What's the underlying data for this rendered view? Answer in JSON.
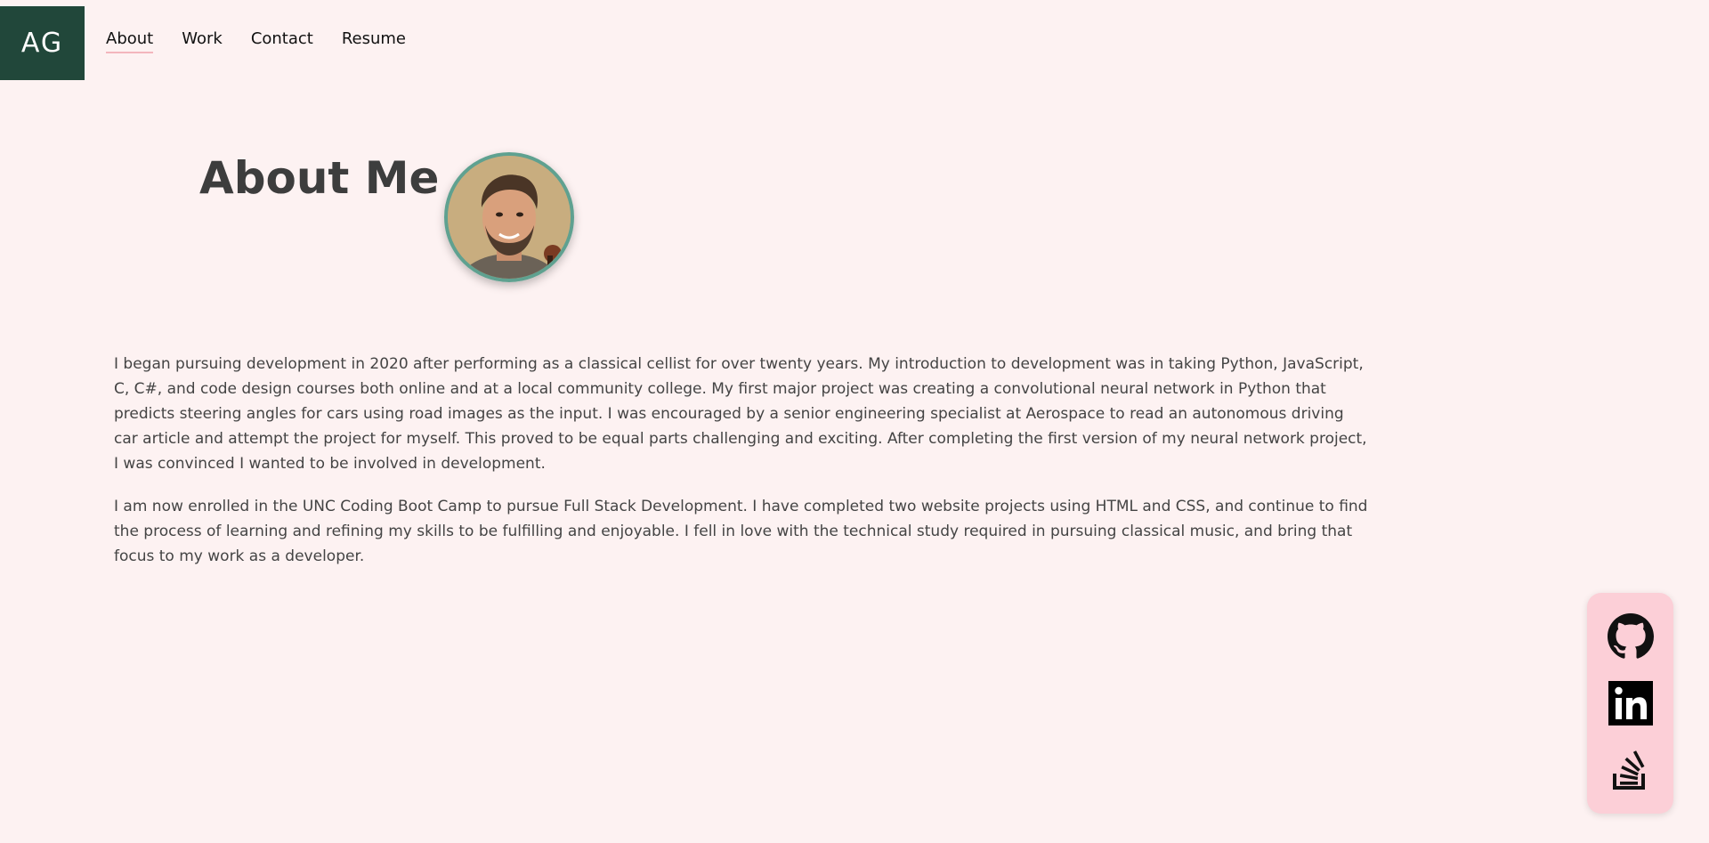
{
  "header": {
    "logo_text": "AG",
    "nav": [
      {
        "label": "About",
        "active": true
      },
      {
        "label": "Work",
        "active": false
      },
      {
        "label": "Contact",
        "active": false
      },
      {
        "label": "Resume",
        "active": false
      }
    ]
  },
  "main": {
    "title": "About Me",
    "avatar_icon": "profile-photo",
    "paragraphs": [
      "I began pursuing development in 2020 after performing as a classical cellist for over twenty years. My introduction to development was in taking Python, JavaScript, C, C#, and code design courses both online and at a local community college. My first major project was creating a convolutional neural network in Python that predicts steering angles for cars using road images as the input. I was encouraged by a senior engineering specialist at Aerospace to read an autonomous driving car article and attempt the project for myself. This proved to be equal parts challenging and exciting. After completing the first version of my neural network project, I was convinced I wanted to be involved in development.",
      "I am now enrolled in the UNC Coding Boot Camp to pursue Full Stack Development. I have completed two website projects using HTML and CSS, and continue to find the process of learning and refining my skills to be fulfilling and enjoyable. I fell in love with the technical study required in pursuing classical music, and bring that focus to my work as a developer."
    ]
  },
  "social": {
    "icons": [
      "github-icon",
      "linkedin-icon",
      "stackoverflow-icon"
    ]
  },
  "colors": {
    "background": "#fdf2f2",
    "logo_bg": "#21473a",
    "avatar_border": "#5fa190",
    "social_bg": "#fccfd7",
    "nav_underline": "#f3b6bd"
  }
}
